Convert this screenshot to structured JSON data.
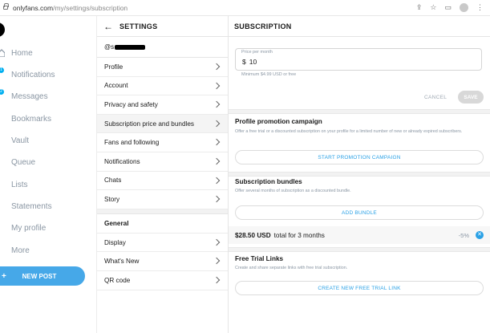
{
  "browser": {
    "url_domain": "onlyfans.com",
    "url_path": "/my/settings/subscription"
  },
  "nav": {
    "items": [
      {
        "label": "Home",
        "icon": "home-icon"
      },
      {
        "label": "Notifications",
        "icon": "bell-icon",
        "badge": "1"
      },
      {
        "label": "Messages",
        "icon": "message-icon",
        "badge": "2"
      },
      {
        "label": "Bookmarks",
        "icon": "bookmark-icon"
      },
      {
        "label": "Vault",
        "icon": "vault-icon"
      },
      {
        "label": "Queue",
        "icon": "queue-icon"
      },
      {
        "label": "Lists",
        "icon": "lists-icon"
      },
      {
        "label": "Statements",
        "icon": "statements-icon"
      },
      {
        "label": "My profile",
        "icon": "profile-icon"
      },
      {
        "label": "More",
        "icon": "more-icon"
      }
    ],
    "new_post": "NEW POST"
  },
  "settings": {
    "title": "SETTINGS",
    "handle": "@s",
    "items": [
      {
        "label": "Profile"
      },
      {
        "label": "Account"
      },
      {
        "label": "Privacy and safety"
      },
      {
        "label": "Subscription price and bundles",
        "active": true
      },
      {
        "label": "Fans and following"
      },
      {
        "label": "Notifications"
      },
      {
        "label": "Chats"
      },
      {
        "label": "Story"
      }
    ],
    "general_header": "General",
    "general_items": [
      {
        "label": "Display"
      },
      {
        "label": "What's New"
      },
      {
        "label": "QR code"
      }
    ]
  },
  "subscription": {
    "title": "SUBSCRIPTION",
    "price_label": "Price per month",
    "currency": "$",
    "price_value": "10",
    "hint": "Minimum $4.99 USD or free",
    "cancel": "CANCEL",
    "save": "SAVE",
    "promo": {
      "title": "Profile promotion campaign",
      "desc": "Offer a free trial or a discounted subscription on your profile for a limited number of new or already expired subscribers.",
      "button": "START PROMOTION CAMPAIGN"
    },
    "bundles": {
      "title": "Subscription bundles",
      "desc": "Offer several months of subscription as a discounted bundle.",
      "button": "ADD BUNDLE",
      "item": {
        "price": "$28.50 USD",
        "desc": "total for 3 months",
        "discount": "-5%"
      }
    },
    "trial": {
      "title": "Free Trial Links",
      "desc": "Create and share separate links with free trial subscription.",
      "button": "CREATE NEW FREE TRIAL LINK"
    }
  }
}
